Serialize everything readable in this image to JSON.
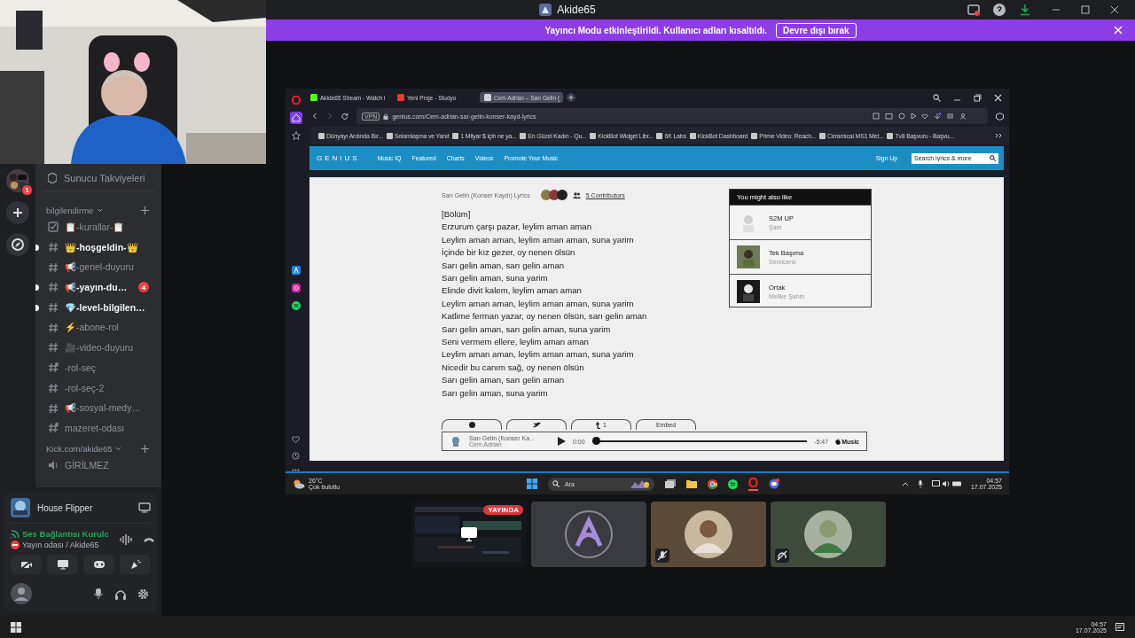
{
  "window": {
    "title": "Akide65"
  },
  "banner": {
    "text": "Yayıncı Modu etkinleştirildi. Kullanıcı adları kısaltıldı.",
    "button": "Devre dışı bırak"
  },
  "server_rail": {
    "badge": "1"
  },
  "channel_list": {
    "boost": "Sunucu Takviyeleri",
    "categories": [
      {
        "name": "bilgilendirme",
        "channels": [
          {
            "kind": "rules",
            "name": "📋-kurallar-📋",
            "unread": false
          },
          {
            "kind": "text",
            "name": "👑-hoşgeldin-👑",
            "unread": true
          },
          {
            "kind": "text",
            "name": "📢-genel-duyuru",
            "unread": false
          },
          {
            "kind": "text",
            "name": "📢-yayın-du…",
            "unread": true,
            "mentions": "4"
          },
          {
            "kind": "text",
            "name": "💎-level-bilgilen…",
            "unread": true
          },
          {
            "kind": "text",
            "name": "⚡-abone-rol",
            "unread": false
          },
          {
            "kind": "text",
            "name": "🎥-video-duyuru",
            "unread": false
          },
          {
            "kind": "locked",
            "name": "-rol-seç",
            "unread": false
          },
          {
            "kind": "text",
            "name": "-rol-seç-2",
            "unread": false
          },
          {
            "kind": "text",
            "name": "📢-sosyal-medy…",
            "unread": false
          },
          {
            "kind": "locked",
            "name": "mazeret-odası",
            "unread": false
          }
        ]
      },
      {
        "name": "Kick.com/akide65",
        "channels": [
          {
            "kind": "voice",
            "name": "GİRİLMEZ",
            "unread": false
          }
        ]
      }
    ]
  },
  "activity": {
    "name": "House Flipper"
  },
  "voice": {
    "status": "Ses Bağlantısı Kurulc",
    "channel": "Yayın odası / Akide65"
  },
  "browser": {
    "tabs": [
      {
        "title": "Akide65 Stream - Watch l",
        "selected": false
      },
      {
        "title": "Yeni Proje - Studyo",
        "selected": false
      },
      {
        "title": "Cem Adrian – Sarı Gelin (",
        "selected": true
      }
    ],
    "vpn": "VPN",
    "url": "genius.com/Cem-adrian-sar-gelin-konser-kayd-lyrics",
    "bookmarks": [
      "Dünyayı Ardında Bır...",
      "Selamlaşma ve Yanıt",
      "1 Milyar $ için ne ya...",
      "En Güzel Kadın - Qu...",
      "KickBot Widget Libr...",
      "6K Labs",
      "KickBot Dashboard",
      "Prime Video: Reach...",
      "Ceramical MS1 Met...",
      "Tv8 Başvuru - Başvu..."
    ]
  },
  "genius": {
    "logo": "GENIUS",
    "nav": [
      "Music IQ",
      "Featured",
      "Charts",
      "Videos",
      "Promote Your Music"
    ],
    "sign_up": "Sign Up",
    "search_placeholder": "Search lyrics & more",
    "song_title": "Sarı Gelin (Konser Kaydı) Lyrics",
    "contributors": "5 Contributors",
    "lyrics": [
      "[Bölüm]",
      "Erzurum çarşı pazar, leylim aman aman",
      "Leylim aman aman, leylim aman aman, suna yarim",
      "İçinde bir kız gezer, oy nenen ölsün",
      "Sarı gelin aman, sarı gelin aman",
      "Sarı gelin aman, suna yarim",
      "Elinde divit kalem, leylim aman aman",
      "Leylim aman aman, leylim aman aman, suna yarim",
      "Katlime ferman yazar, oy nenen ölsün, sarı gelin aman",
      "Sarı gelin aman, sarı gelin aman, suna yarim",
      "Seni vermem ellere, leylim aman aman",
      "Leylim aman aman, leylim aman aman, suna yarim",
      "Nicedir bu canım sağ, oy nenen ölsün",
      "Sarı gelin aman, sarı gelin aman",
      "Sarı gelin aman, suna yarim"
    ],
    "share": [
      {
        "kind": "facebook"
      },
      {
        "kind": "twitter"
      },
      {
        "kind": "tumblr",
        "label": "1"
      },
      {
        "kind": "text",
        "label": "Embed"
      }
    ],
    "also_like": {
      "title": "You might also like",
      "songs": [
        {
          "title": "S2M UP",
          "artist": "Şam"
        },
        {
          "title": "Tek Başıma",
          "artist": "Semicenk"
        },
        {
          "title": "Ortak",
          "artist": "Melike Şahin"
        }
      ]
    },
    "player": {
      "title": "Sarı Gelin (Konser Ka...",
      "artist": "Cem Adrian",
      "elapsed": "0:00",
      "level": 0,
      "remaining": "-5:47",
      "service": "Music"
    }
  },
  "shared_taskbar": {
    "temperature": "26°C",
    "weather": "Çok bulutlu",
    "search": "Ara",
    "time": "04:57",
    "date": "17.07.2025"
  },
  "tiles": [
    {
      "kind": "screen",
      "badge": "YAYINDA",
      "muted": false,
      "deafened": false
    },
    {
      "kind": "avatar",
      "muted": false,
      "deafened": false
    },
    {
      "kind": "person",
      "muted": true,
      "deafened": false
    },
    {
      "kind": "person",
      "muted": false,
      "deafened": true
    }
  ],
  "taskbar": {
    "time": "04:57",
    "date": "17.07.2025"
  }
}
